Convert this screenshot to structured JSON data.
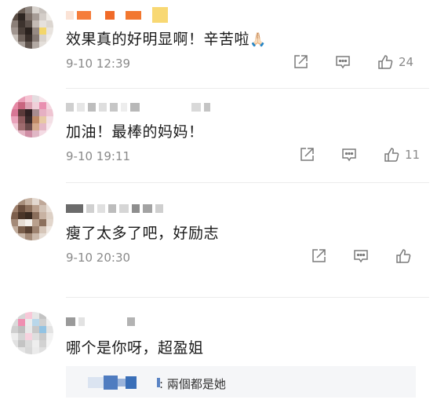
{
  "comments": [
    {
      "text": "效果真的好明显啊！辛苦啦",
      "emoji": "🙏🏻",
      "time": "9-10 12:39",
      "likes": "24"
    },
    {
      "text": "加油！最棒的妈妈！",
      "time": "9-10 19:11",
      "likes": "11"
    },
    {
      "text": "瘦了太多了吧，好励志",
      "time": "9-10 20:30",
      "likes": ""
    },
    {
      "text": "哪个是你呀，超盈姐",
      "reply": ": 兩個都是她"
    }
  ],
  "icons": {
    "share": "share-icon",
    "reply": "comment-icon",
    "like": "thumb-up-icon"
  },
  "colors": {
    "time": "#8a8a8a",
    "icon": "#7a7a7a",
    "reply_bg": "#f5f6f8",
    "reply_name": "#3a6fb8"
  }
}
